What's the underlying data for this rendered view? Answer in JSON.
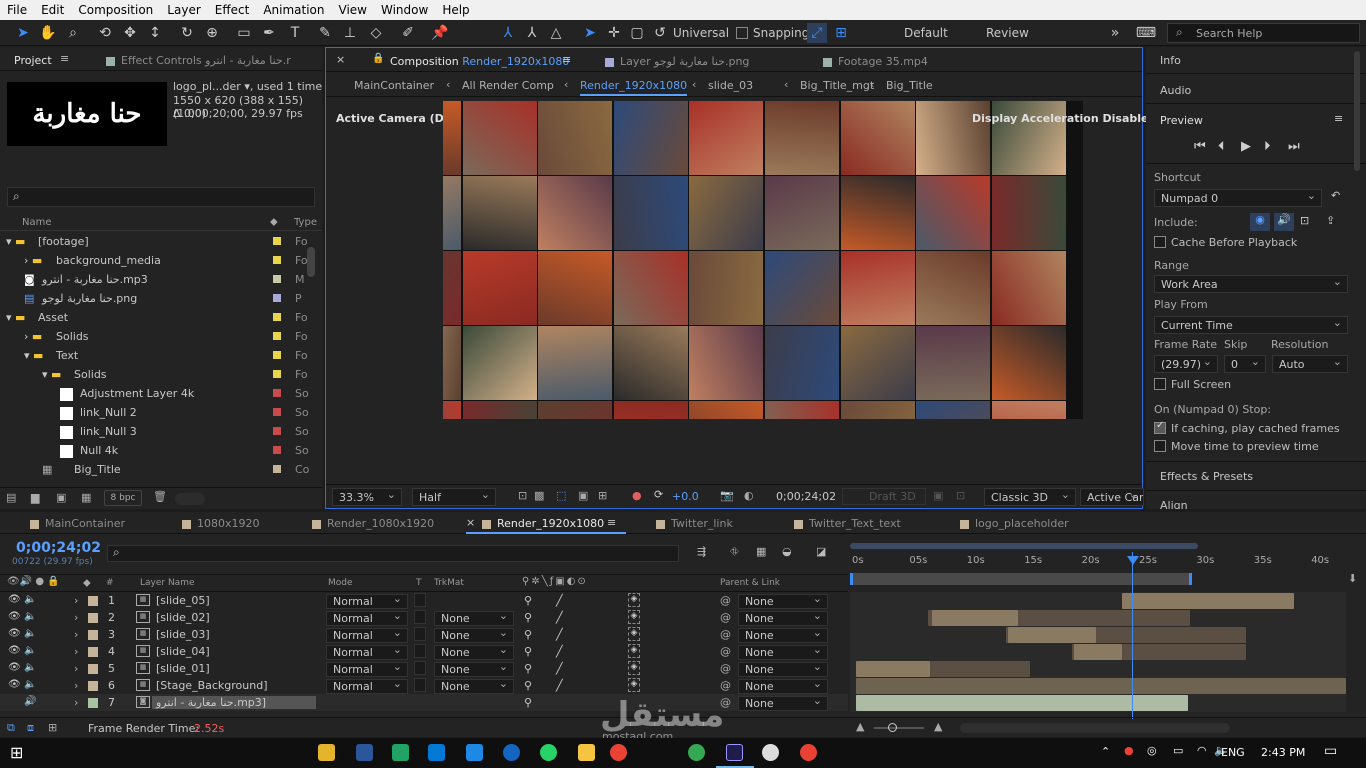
{
  "menu": [
    "File",
    "Edit",
    "Composition",
    "Layer",
    "Effect",
    "Animation",
    "View",
    "Window",
    "Help"
  ],
  "toolbar": {
    "universal_label": "Universal",
    "snapping_label": "Snapping",
    "workspaces": [
      "Default",
      "Review"
    ],
    "search_placeholder": "Search Help"
  },
  "project_panel": {
    "tab_project": "Project",
    "tab_effect_controls": "Effect Controls حنا مغاربة - انترو.r",
    "item_name": "logo_pl...der",
    "item_used": ", used 1 time",
    "item_size": "1550 x 620  (388 x 155) (1.00)",
    "item_duration": "Δ 0;00;20;00, 29.97 fps",
    "thumb_text": "حنا مغاربة",
    "col_name": "Name",
    "col_type": "Type",
    "bpc": "8 bpc",
    "rows": [
      {
        "label": "[footage]",
        "type": "Fo",
        "color": "#e8d44d"
      },
      {
        "label": "background_media",
        "type": "Fo",
        "color": "#e8d44d"
      },
      {
        "label": "حنا مغاربة - انترو.mp3",
        "type": "M",
        "color": "#c9c9a4"
      },
      {
        "label": "حنا مغاربة لوجو.png",
        "type": "P",
        "color": "#a9a9d9"
      },
      {
        "label": "Asset",
        "type": "Fo",
        "color": "#e8d44d"
      },
      {
        "label": "Solids",
        "type": "Fo",
        "color": "#e8d44d"
      },
      {
        "label": "Text",
        "type": "Fo",
        "color": "#e8d44d"
      },
      {
        "label": "Solids",
        "type": "Fo",
        "color": "#e8d44d"
      },
      {
        "label": "Adjustment Layer 4k",
        "type": "So",
        "color": "#c94b4b"
      },
      {
        "label": "link_Null 2",
        "type": "So",
        "color": "#c94b4b"
      },
      {
        "label": "link_Null 3",
        "type": "So",
        "color": "#c94b4b"
      },
      {
        "label": "Null  4k",
        "type": "So",
        "color": "#c94b4b"
      },
      {
        "label": "Big_Title",
        "type": "Co",
        "color": "#c5b49a"
      }
    ]
  },
  "comp_panel": {
    "tab_comp_prefix": "Composition",
    "tab_comp_name": "Render_1920x1080",
    "tab_layer": "Layer  حنا مغاربة لوجو.png",
    "tab_footage": "Footage  35.mp4",
    "breadcrumbs": [
      "MainContainer",
      "All Render Comp",
      "Render_1920x1080",
      "slide_03",
      "Big_Title_mgt",
      "Big_Title"
    ],
    "active_camera": "Active Camera (Default)",
    "display_accel": "Display Acceleration Disabled",
    "zoom": "33.3%",
    "resolution": "Half",
    "exposure": "+0.0",
    "timecode": "0;00;24;02",
    "draft3d": "Draft 3D",
    "renderer": "Classic 3D",
    "view": "Active Cam"
  },
  "right_panel": {
    "info": "Info",
    "audio": "Audio",
    "preview": "Preview",
    "shortcut_label": "Shortcut",
    "shortcut_value": "Numpad 0",
    "include_label": "Include:",
    "cache_before": "Cache Before Playback",
    "range_label": "Range",
    "range_value": "Work Area",
    "play_from_label": "Play From",
    "play_from_value": "Current Time",
    "frame_rate_label": "Frame Rate",
    "skip_label": "Skip",
    "resolution_label": "Resolution",
    "frame_rate_value": "(29.97)",
    "skip_value": "0",
    "resolution_value": "Auto",
    "full_screen": "Full Screen",
    "on_stop": "On (Numpad 0) Stop:",
    "if_caching": "If caching, play cached frames",
    "move_time": "Move time to preview time",
    "effects_presets": "Effects & Presets",
    "align": "Align"
  },
  "timeline": {
    "tabs": [
      {
        "label": "MainContainer",
        "color": "#c5b49a"
      },
      {
        "label": "1080x1920",
        "color": "#c5b49a"
      },
      {
        "label": "Render_1080x1920",
        "color": "#c5b49a"
      },
      {
        "label": "Render_1920x1080",
        "color": "#c5b49a"
      },
      {
        "label": "Twitter_link",
        "color": "#c5b49a"
      },
      {
        "label": "Twitter_Text_text",
        "color": "#c5b49a"
      },
      {
        "label": "logo_placeholder",
        "color": "#c5b49a"
      }
    ],
    "timecode": "0;00;24;02",
    "frame_info": "00722 (29.97 fps)",
    "col_layer_name": "Layer Name",
    "col_mode": "Mode",
    "col_t": "T",
    "col_trkmat": "TrkMat",
    "col_parent": "Parent & Link",
    "ruler": [
      "0s",
      "05s",
      "10s",
      "15s",
      "20s",
      "25s",
      "30s",
      "35s",
      "40s"
    ],
    "layers": [
      {
        "num": "1",
        "name": "[slide_05]",
        "mode": "Normal",
        "trkmat": "",
        "parent": "None",
        "color": "#c5b49a"
      },
      {
        "num": "2",
        "name": "[slide_02]",
        "mode": "Normal",
        "trkmat": "None",
        "parent": "None",
        "color": "#c5b49a"
      },
      {
        "num": "3",
        "name": "[slide_03]",
        "mode": "Normal",
        "trkmat": "None",
        "parent": "None",
        "color": "#c5b49a"
      },
      {
        "num": "4",
        "name": "[slide_04]",
        "mode": "Normal",
        "trkmat": "None",
        "parent": "None",
        "color": "#c5b49a"
      },
      {
        "num": "5",
        "name": "[slide_01]",
        "mode": "Normal",
        "trkmat": "None",
        "parent": "None",
        "color": "#c5b49a"
      },
      {
        "num": "6",
        "name": "[Stage_Background]",
        "mode": "Normal",
        "trkmat": "None",
        "parent": "None",
        "color": "#c5b49a"
      },
      {
        "num": "7",
        "name": "حنا مغاربة - انترو.mp3]",
        "mode": "",
        "trkmat": "",
        "parent": "None",
        "color": "#a8c4a0"
      }
    ],
    "frame_render_label": "Frame Render Time:",
    "frame_render_value": "2.52s"
  },
  "taskbar": {
    "language": "ENG",
    "time": "2:43 PM"
  },
  "watermark": {
    "arabic": "مستقل",
    "latin": "mostaql.com"
  }
}
